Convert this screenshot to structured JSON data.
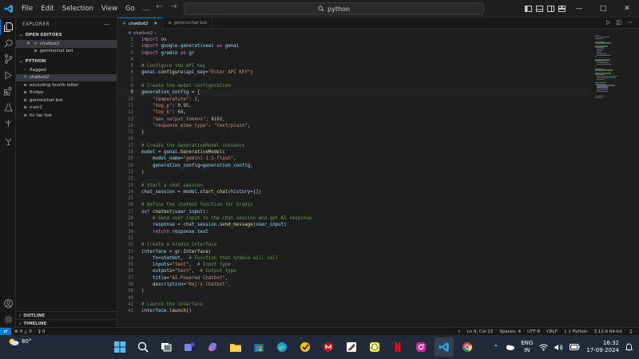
{
  "titlebar": {
    "menu": [
      "File",
      "Edit",
      "Selection",
      "View",
      "Go",
      "…"
    ],
    "search_text": "python"
  },
  "sidebar": {
    "title": "EXPLORER",
    "open_editors_label": "OPEN EDITORS",
    "open_editors": [
      {
        "name": "chatbot2",
        "selected": true
      },
      {
        "name": "geminichat bot",
        "selected": false
      }
    ],
    "folder_label": "PYTHON",
    "files": [
      {
        "name": "flagged",
        "kind": "folder"
      },
      {
        "name": "chatbot2",
        "kind": "python",
        "selected": true
      },
      {
        "name": "excluding fourth letter",
        "kind": "file"
      },
      {
        "name": "firstpy",
        "kind": "file"
      },
      {
        "name": "geminichat bot",
        "kind": "file"
      },
      {
        "name": "num2",
        "kind": "file"
      },
      {
        "name": "tic tac toe",
        "kind": "file"
      }
    ],
    "outline_label": "OUTLINE",
    "timeline_label": "TIMELINE"
  },
  "tabs": [
    {
      "label": "chatbot2",
      "active": true
    },
    {
      "label": "geminichat bot",
      "active": false
    }
  ],
  "breadcrumb": [
    "chatbot2",
    "..."
  ],
  "code": {
    "current_line": 9,
    "lines": [
      "import os",
      "import google.generativeai as genai",
      "import gradio as gr",
      "",
      "# Configure the API key",
      "genai.configure(api_key=\"Enter API KEY\")",
      "",
      "# Create the model configuration",
      "generation_config = {",
      "    \"temperature\": 1,",
      "    \"top_p\": 0.95,",
      "    \"top_k\": 64,",
      "    \"max_output_tokens\": 8192,",
      "    \"response_mime_type\": \"text/plain\",",
      "}",
      "",
      "# Create the GenerativeModel instance",
      "model = genai.GenerativeModel(",
      "    model_name=\"gemini-1.5-flash\",",
      "    generation_config=generation_config,",
      ")",
      "",
      "# Start a chat session",
      "chat_session = model.start_chat(history=[])",
      "",
      "# Define the chatbot function for Gradio",
      "def chatbot(user_input):",
      "    # Send user input to the chat session and get AI response",
      "    response = chat_session.send_message(user_input)",
      "    return response.text",
      "",
      "# Create a Gradio interface",
      "interface = gr.Interface(",
      "    fn=chatbot,  # Function that Gradio will call",
      "    inputs=\"text\",  # Input type",
      "    outputs=\"text\",  # Output type",
      "    title=\"AI-Powered Chatbot\",",
      "    description=\"Raj's Chatbot\",",
      ")",
      "",
      "# Launch the interface",
      "interface.launch()"
    ]
  },
  "statusbar": {
    "errors": "0",
    "warnings": "0",
    "ports": "0",
    "position": "Ln 9, Col 22",
    "spaces": "Spaces: 4",
    "encoding": "UTF-8",
    "eol": "CRLF",
    "language": "{ } Python",
    "interpreter": "3.12.6 64-bit"
  },
  "taskbar": {
    "temperature": "80°",
    "language": "ENG",
    "region": "IN",
    "time": "16:32",
    "date": "17-09-2024"
  },
  "colors": {
    "accent": "#0078d4",
    "keyword": "#c586c0",
    "comment": "#6a9955",
    "string": "#ce9178",
    "number": "#b5cea8",
    "function": "#dcdcaa",
    "variable": "#9cdcfe"
  }
}
